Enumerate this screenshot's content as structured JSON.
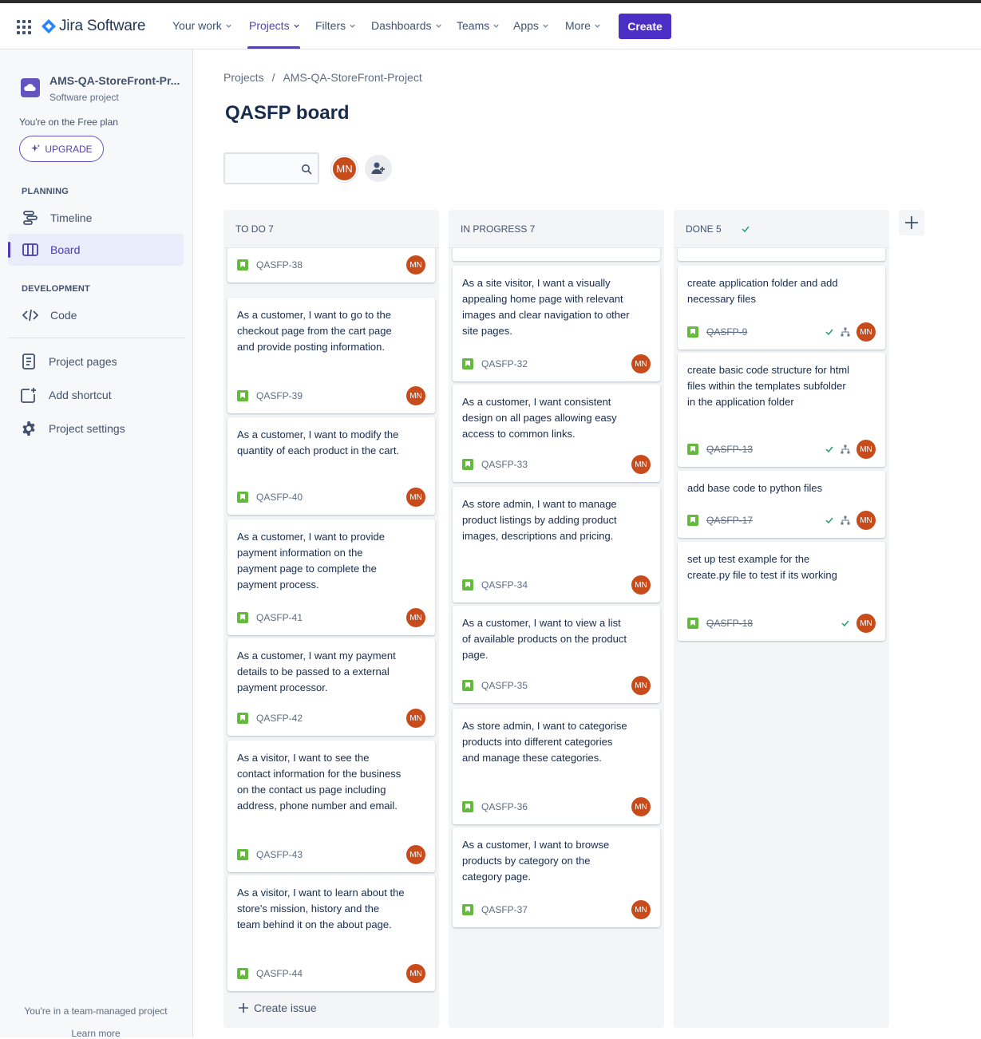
{
  "app": {
    "product_name": "Jira Software"
  },
  "topnav": {
    "items": [
      {
        "label": "Your work"
      },
      {
        "label": "Projects"
      },
      {
        "label": "Filters"
      },
      {
        "label": "Dashboards"
      },
      {
        "label": "Teams"
      },
      {
        "label": "Apps"
      },
      {
        "label": "More"
      }
    ],
    "create_label": "Create"
  },
  "sidebar": {
    "project_name": "AMS-QA-StoreFront-Pr...",
    "project_type": "Software project",
    "plan_text": "You're on the Free plan",
    "upgrade_label": "UPGRADE",
    "planning_label": "PLANNING",
    "timeline_label": "Timeline",
    "board_label": "Board",
    "development_label": "DEVELOPMENT",
    "code_label": "Code",
    "project_pages_label": "Project pages",
    "add_shortcut_label": "Add shortcut",
    "project_settings_label": "Project settings",
    "footer_text": "You're in a team-managed project",
    "learn_more": "Learn more"
  },
  "breadcrumb": {
    "root": "Projects",
    "separator": "/",
    "project": "AMS-QA-StoreFront-Project"
  },
  "board": {
    "title": "QASFP board",
    "search_placeholder": "",
    "user_initials": "MN",
    "create_issue_label": "Create issue",
    "columns": [
      {
        "title": "TO DO 7",
        "cards": [
          {
            "summary": "",
            "key": "QASFP-38",
            "assignee": "MN"
          },
          {
            "summary": "As a customer, I want to go to the checkout page from the cart page and provide posting information.",
            "key": "QASFP-39",
            "assignee": "MN"
          },
          {
            "summary": "As a customer, I want to modify the quantity of each product in the cart.",
            "key": "QASFP-40",
            "assignee": "MN"
          },
          {
            "summary": "As a customer, I want to provide payment information on the payment page to complete the payment process.",
            "key": "QASFP-41",
            "assignee": "MN"
          },
          {
            "summary": "As a customer, I want my payment details to be passed to a external payment processor.",
            "key": "QASFP-42",
            "assignee": "MN"
          },
          {
            "summary": "As a visitor, I want to see the contact information for the business on the contact us page including address, phone number and email.",
            "key": "QASFP-43",
            "assignee": "MN"
          },
          {
            "summary": "As a visitor, I want to learn about the store's mission, history and the team behind it on the about page.",
            "key": "QASFP-44",
            "assignee": "MN"
          }
        ]
      },
      {
        "title": "IN PROGRESS 7",
        "cards": [
          {
            "summary": "As a site visitor, I want a visually appealing home page with relevant images and clear navigation to other site pages.",
            "key": "QASFP-32",
            "assignee": "MN"
          },
          {
            "summary": "As a customer, I want consistent design on all pages allowing easy access to common links.",
            "key": "QASFP-33",
            "assignee": "MN"
          },
          {
            "summary": "As store admin, I want to manage product listings by adding product images, descriptions and pricing.",
            "key": "QASFP-34",
            "assignee": "MN"
          },
          {
            "summary": "As a customer, I want to view a list of available products on the product page.",
            "key": "QASFP-35",
            "assignee": "MN"
          },
          {
            "summary": "As store admin, I want to categorise products into different categories and manage these categories.",
            "key": "QASFP-36",
            "assignee": "MN"
          },
          {
            "summary": "As a customer, I want to browse products by category on the category page.",
            "key": "QASFP-37",
            "assignee": "MN"
          }
        ]
      },
      {
        "title": "DONE 5",
        "cards": [
          {
            "summary": "create application folder and add necessary files",
            "key": "QASFP-9",
            "assignee": "MN"
          },
          {
            "summary": "create basic code structure for html files within the templates subfolder in the application folder",
            "key": "QASFP-13",
            "assignee": "MN"
          },
          {
            "summary": "add base code to python files",
            "key": "QASFP-17",
            "assignee": "MN"
          },
          {
            "summary": "set up test example for the create.py file to test if its working",
            "key": "QASFP-18",
            "assignee": "MN"
          }
        ]
      }
    ]
  },
  "colors": {
    "accent": "#5243aa",
    "create_button": "#4b2fc4",
    "avatar": "#c74b1b",
    "story": "#63ba3c"
  }
}
